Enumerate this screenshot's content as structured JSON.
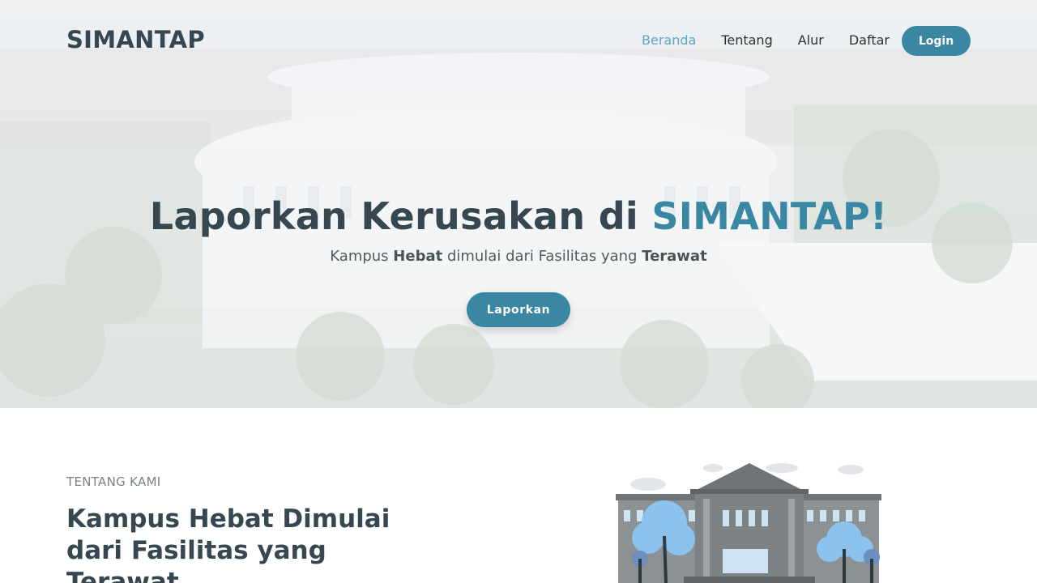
{
  "brand": "SIMANTAP",
  "nav": {
    "items": [
      {
        "label": "Beranda",
        "active": true
      },
      {
        "label": "Tentang",
        "active": false
      },
      {
        "label": "Alur",
        "active": false
      },
      {
        "label": "Daftar",
        "active": false
      }
    ],
    "login_label": "Login"
  },
  "hero": {
    "title_prefix": "Laporkan Kerusakan di ",
    "title_accent": "SIMANTAP!",
    "subtitle_parts": [
      "Kampus ",
      "Hebat",
      " dimulai dari Fasilitas yang ",
      "Terawat"
    ],
    "cta_label": "Laporkan"
  },
  "about": {
    "label": "TENTANG KAMI",
    "title": "Kampus Hebat Dimulai dari Fasilitas yang Terawat"
  },
  "colors": {
    "accent": "#3a87a3",
    "nav_active": "#5aa7c6",
    "text_dark": "#37474f"
  }
}
